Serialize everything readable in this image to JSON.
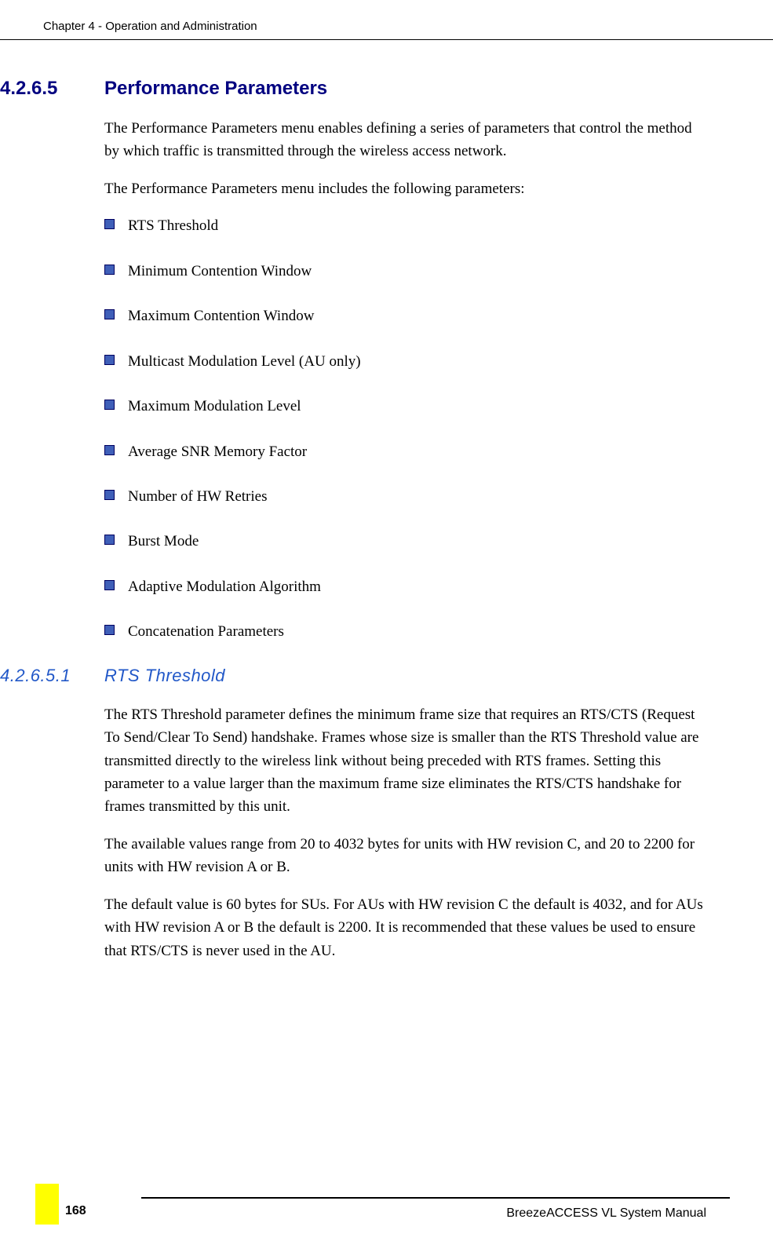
{
  "header": {
    "chapter": "Chapter 4 - Operation and Administration"
  },
  "section1": {
    "number": "4.2.6.5",
    "title": "Performance Parameters",
    "intro1": "The Performance Parameters menu enables defining a series of parameters that control the method by which traffic is transmitted through the wireless access network.",
    "intro2": "The Performance Parameters menu includes the following parameters:",
    "bullets": [
      "RTS Threshold",
      "Minimum Contention Window",
      "Maximum Contention Window",
      "Multicast Modulation Level (AU only)",
      "Maximum Modulation Level",
      "Average SNR Memory Factor",
      "Number of HW Retries",
      "Burst Mode",
      "Adaptive Modulation Algorithm",
      "Concatenation Parameters"
    ]
  },
  "section2": {
    "number": "4.2.6.5.1",
    "title": "RTS Threshold",
    "para1": "The RTS Threshold parameter defines the minimum frame size that requires an RTS/CTS (Request To Send/Clear To Send) handshake. Frames whose size is smaller than the RTS Threshold value are transmitted directly to the wireless link without being preceded with RTS frames. Setting this parameter to a value larger than the maximum frame size eliminates the RTS/CTS handshake for frames transmitted by this unit.",
    "para2": "The available values range from 20 to 4032 bytes for units with HW revision C, and 20 to 2200 for units with HW revision A or B.",
    "para3": "The default value is 60 bytes for SUs. For AUs with HW revision C the default is 4032, and for AUs with HW revision A or B the default is 2200. It is recommended that these values be used to ensure that RTS/CTS is never used in the AU."
  },
  "footer": {
    "manual": "BreezeACCESS VL System Manual",
    "page": "168"
  }
}
